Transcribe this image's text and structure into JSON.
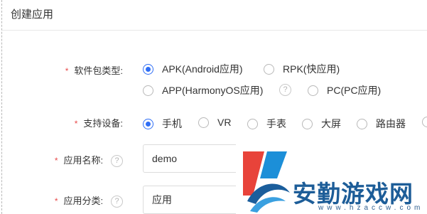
{
  "header": {
    "title": "创建应用"
  },
  "form": {
    "package_type": {
      "label": "软件包类型:",
      "options": [
        {
          "label": "APK(Android应用)",
          "selected": true
        },
        {
          "label": "RPK(快应用)",
          "selected": false
        },
        {
          "label": "APP(HarmonyOS应用)",
          "selected": false
        },
        {
          "label": "PC(PC应用)",
          "selected": false
        }
      ]
    },
    "devices": {
      "label": "支持设备:",
      "options": [
        {
          "label": "手机",
          "selected": true
        },
        {
          "label": "VR",
          "selected": false
        },
        {
          "label": "手表",
          "selected": false
        },
        {
          "label": "大屏",
          "selected": false
        },
        {
          "label": "路由器",
          "selected": false
        }
      ]
    },
    "app_name": {
      "label": "应用名称:",
      "value": "demo"
    },
    "app_category": {
      "label": "应用分类:",
      "value": "应用"
    }
  },
  "watermark": {
    "title": "安勤游戏网",
    "url": "www.hzaccw.com"
  },
  "colors": {
    "accent": "#2f6ef5",
    "required": "#e84c4c"
  }
}
